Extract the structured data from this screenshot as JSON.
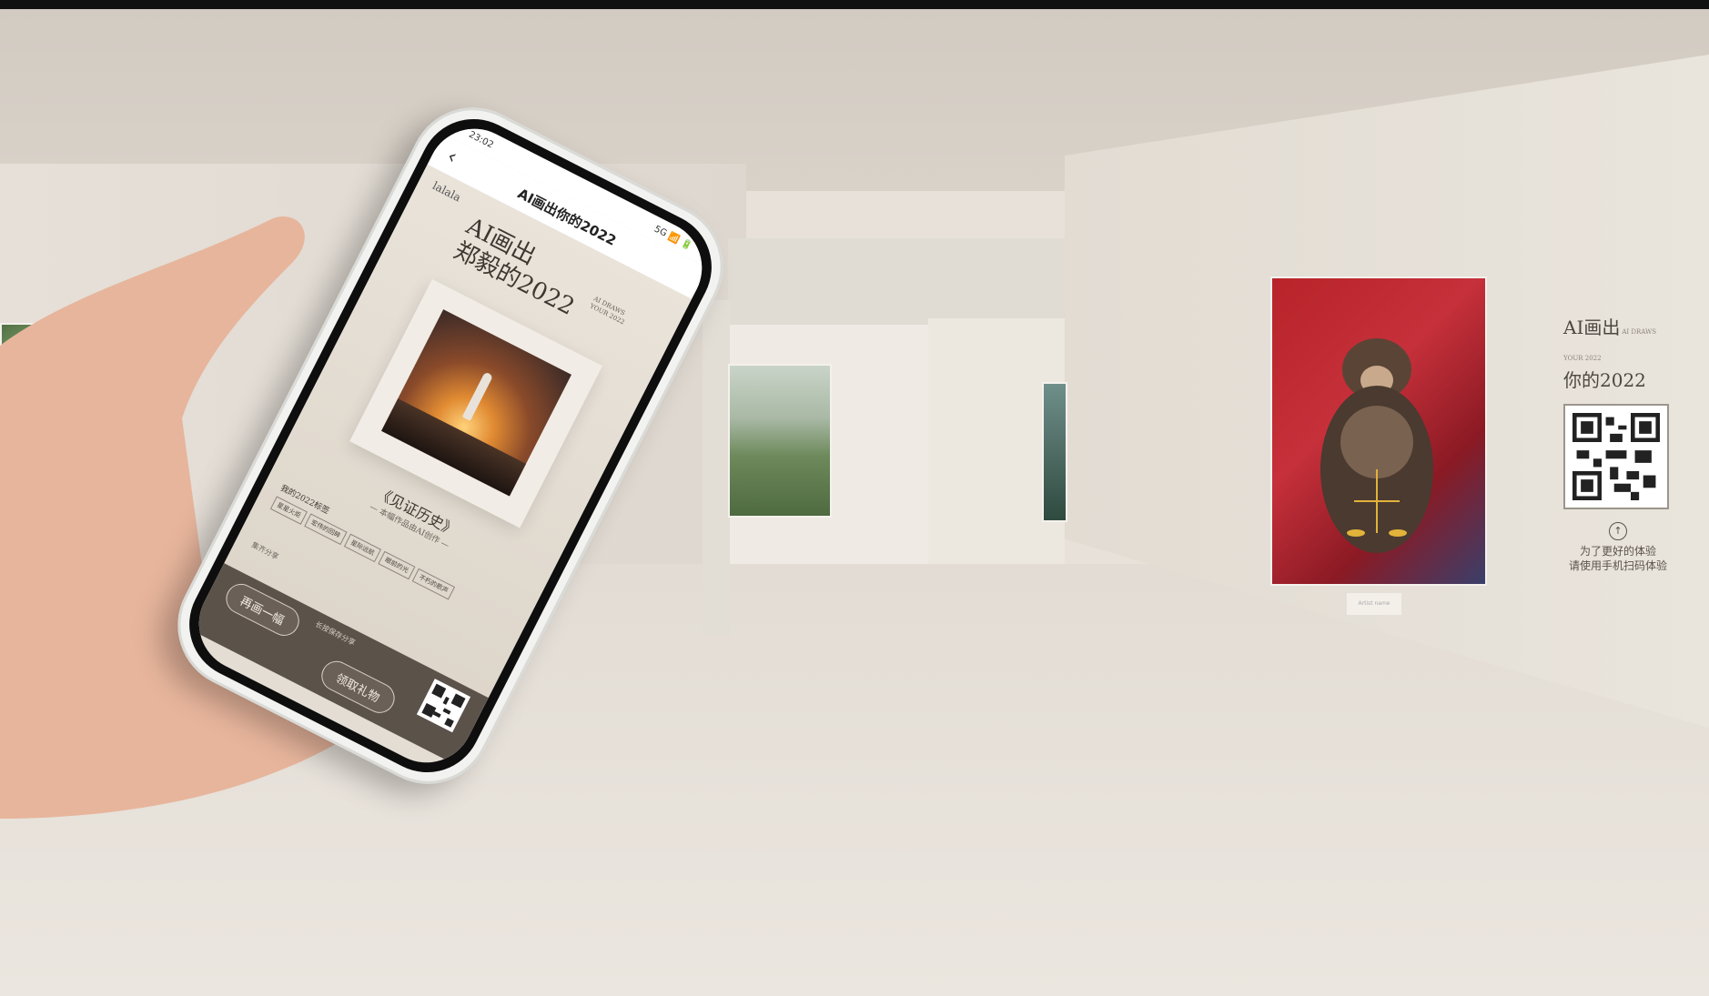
{
  "gallery": {
    "right_panel": {
      "title_line1": "AI画出",
      "title_line1_sub": "AI DRAWS YOUR 2022",
      "title_line2": "你的2022",
      "hint_line1": "为了更好的体验",
      "hint_line2": "请使用手机扫码体验"
    },
    "plaque_text": "Artist name"
  },
  "phone": {
    "status_time": "23:02",
    "status_icons": "5G 📶 🔋",
    "nav_title": "AI画出你的2022",
    "logo_text": "lalala",
    "headline_line1": "AI画出",
    "headline_line2": "郑毅的2022",
    "headline_sub_line1": "AI DRAWS",
    "headline_sub_line2": "YOUR 2022",
    "work_title": "《见证历史》",
    "work_subtitle": "— 本幅作品由AI创作 —",
    "section_label": "我的2022标签",
    "tags": [
      "星星火炬",
      "宏伟的回眸",
      "星际远航",
      "眼前的光",
      "不朽的歌声"
    ],
    "collect_label": "集齐分享",
    "bottom_hint": "长按保存分享",
    "button_left": "再画一幅",
    "button_right": "领取礼物"
  }
}
